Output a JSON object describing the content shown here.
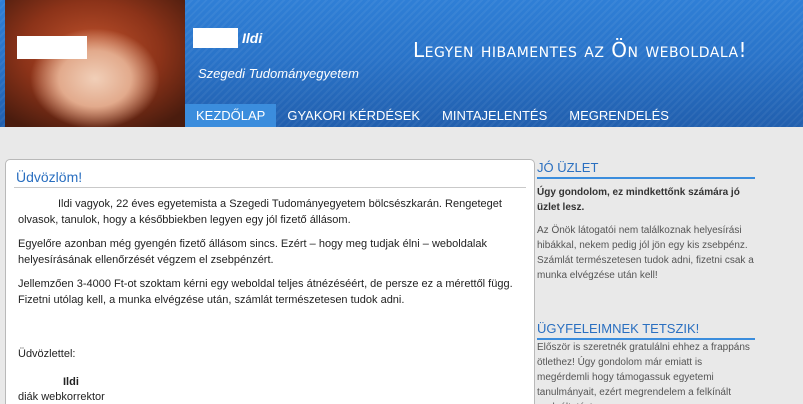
{
  "header": {
    "name": "Ildi",
    "university": "Szegedi Tudományegyetem",
    "slogan": "Legyen hibamentes az Ön weboldala!"
  },
  "nav": {
    "items": [
      {
        "label": "Kezdőlap"
      },
      {
        "label": "Gyakori kérdések"
      },
      {
        "label": "Mintajelentés"
      },
      {
        "label": "Megrendelés"
      }
    ]
  },
  "main": {
    "title": "Üdvözlöm!",
    "paragraphs": [
      "Ildi vagyok, 22 éves egyetemista a Szegedi Tudományegyetem bölcsészkarán. Rengeteget olvasok, tanulok, hogy a későbbiekben legyen egy jól fizető állásom.",
      "Egyelőre azonban még gyengén fizető állásom sincs. Ezért – hogy meg tudjak élni – weboldalak helyesírásának ellenőrzését végzem el zsebpénzért.",
      "Jellemzően 3-4000 Ft-ot szoktam kérni egy weboldal teljes átnézéséért, de persze ez a mérettől függ. Fizetni utólag kell, a munka elvégzése után, számlát természetesen tudok adni."
    ],
    "greeting": "Üdvözlettel:",
    "signature_name": "Ildi",
    "signature_role": "diák webkorrektor"
  },
  "sidebar": {
    "box1": {
      "title": "Jó üzlet",
      "lead": "Úgy gondolom, ez mindkettőnk számára jó üzlet lesz.",
      "text": "Az Önök látogatói nem találkoznak helyesírási hibákkal, nekem pedig jól jön egy kis zsebpénz. Számlát természetesen tudok adni, fizetni csak a munka elvégzése után kell!"
    },
    "box2": {
      "title": "Ügyfeleimnek tetszik!",
      "text": "Először is szeretnék gratulálni ehhez a frappáns ötlethez! Úgy gondolom már emiatt is megérdemli hogy támogassuk egyetemi tanulmányait, ezért megrendelem a felkínált szolgáltatást."
    }
  }
}
